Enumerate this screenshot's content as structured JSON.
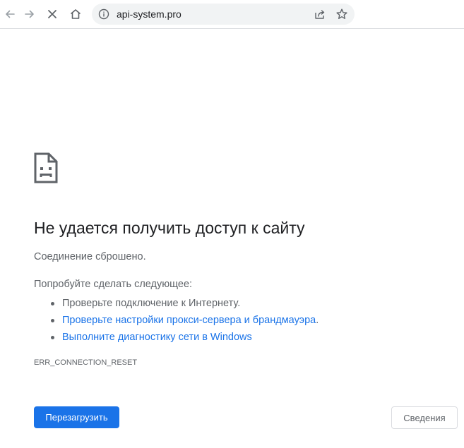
{
  "browser": {
    "url": "api-system.pro",
    "icons": [
      "back-icon",
      "forward-icon",
      "stop-icon",
      "home-icon",
      "info-icon",
      "share-icon",
      "star-icon"
    ]
  },
  "error_page": {
    "icon": "sad-page-icon",
    "heading": "Не удается получить доступ к сайту",
    "subtitle": "Соединение сброшено.",
    "suggestions_title": "Попробуйте сделать следующее:",
    "suggestions": [
      {
        "text": "Проверьте подключение к Интернету.",
        "link": false
      },
      {
        "text": "Проверьте настройки прокси-сервера и брандмауэра",
        "suffix": ".",
        "link": true
      },
      {
        "text": "Выполните диагностику сети в Windows",
        "link": true
      }
    ],
    "error_code": "ERR_CONNECTION_RESET",
    "reload_label": "Перезагрузить",
    "details_label": "Сведения"
  },
  "colors": {
    "accent": "#1a73e8",
    "text_secondary": "#5f6368",
    "omnibox_bg": "#f1f3f4"
  }
}
